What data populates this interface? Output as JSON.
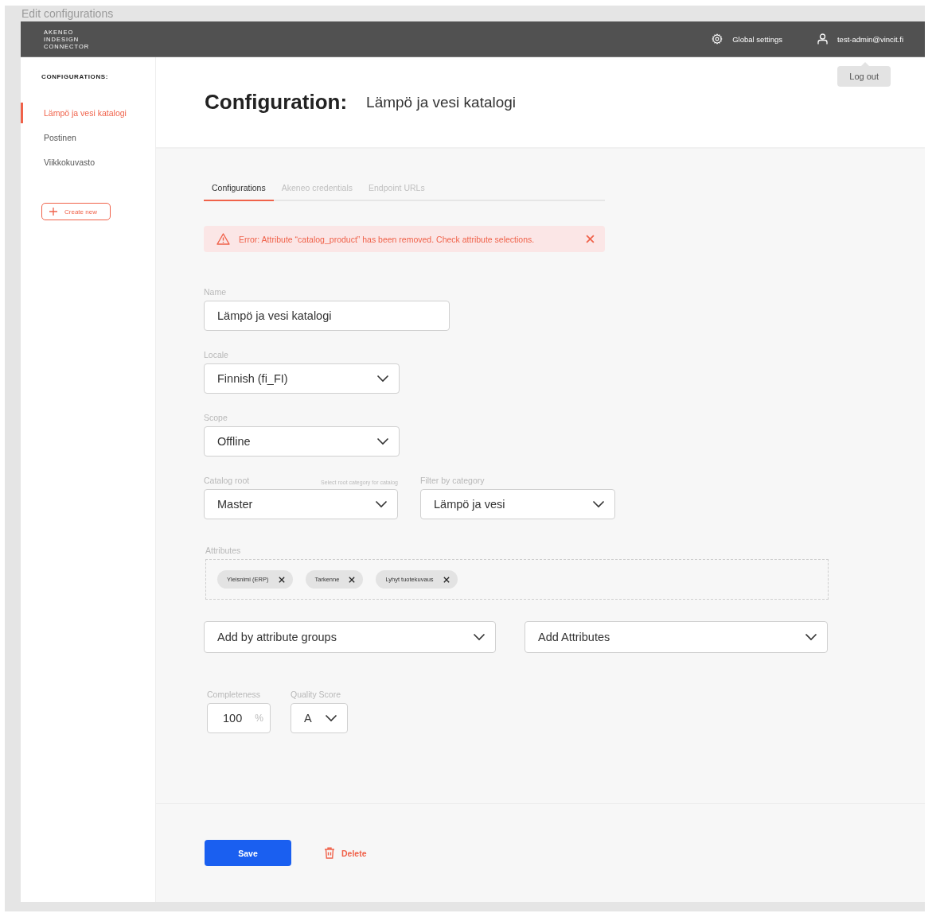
{
  "window": {
    "title": "Edit configurations"
  },
  "header": {
    "logo_lines": [
      "AKENEO",
      "INDESIGN",
      "CONNECTOR"
    ],
    "global_settings": "Global settings",
    "user": "test-admin@vincit.fi",
    "user_menu": [
      "Log out"
    ]
  },
  "sidebar": {
    "heading": "CONFIGURATIONS:",
    "items": [
      {
        "label": "Lämpö ja vesi katalogi",
        "selected": true
      },
      {
        "label": "Postinen",
        "selected": false
      },
      {
        "label": "Viikkokuvasto",
        "selected": false
      }
    ],
    "create_button": "Create new"
  },
  "page": {
    "title": "Configuration:",
    "subtitle": "Lämpö ja vesi katalogi"
  },
  "tabs": [
    {
      "label": "Configurations",
      "selected": true
    },
    {
      "label": "Akeneo credentials",
      "selected": false
    },
    {
      "label": "Endpoint URLs",
      "selected": false
    }
  ],
  "error": {
    "message": "Error: Attribute “catalog_product” has been removed. Check attribute selections."
  },
  "name": {
    "label": "Name",
    "value": "Lämpö ja vesi katalogi"
  },
  "locale": {
    "label": "Locale",
    "value": "Finnish (fi_FI)"
  },
  "scope": {
    "label": "Scope",
    "value": "Offline"
  },
  "catalog_root": {
    "label": "Catalog root",
    "hint": "Select root category for catalog",
    "value": "Master"
  },
  "filter_by_category": {
    "label": "Filter by category",
    "value": "Lämpö ja vesi"
  },
  "attributes": {
    "label": "Attributes",
    "tags": [
      "Yleisnimi (ERP)",
      "Tarkenne",
      "Lyhyt tuotekuvaus"
    ]
  },
  "add_by_attribute_groups": {
    "value": "Add by attribute groups"
  },
  "add_attributes": {
    "value": "Add Attributes"
  },
  "completeness": {
    "label": "Completeness",
    "value": "100",
    "unit": "%"
  },
  "quality_score": {
    "label": "Quality Score",
    "value": "A"
  },
  "actions": {
    "save": "Save",
    "delete": "Delete"
  }
}
